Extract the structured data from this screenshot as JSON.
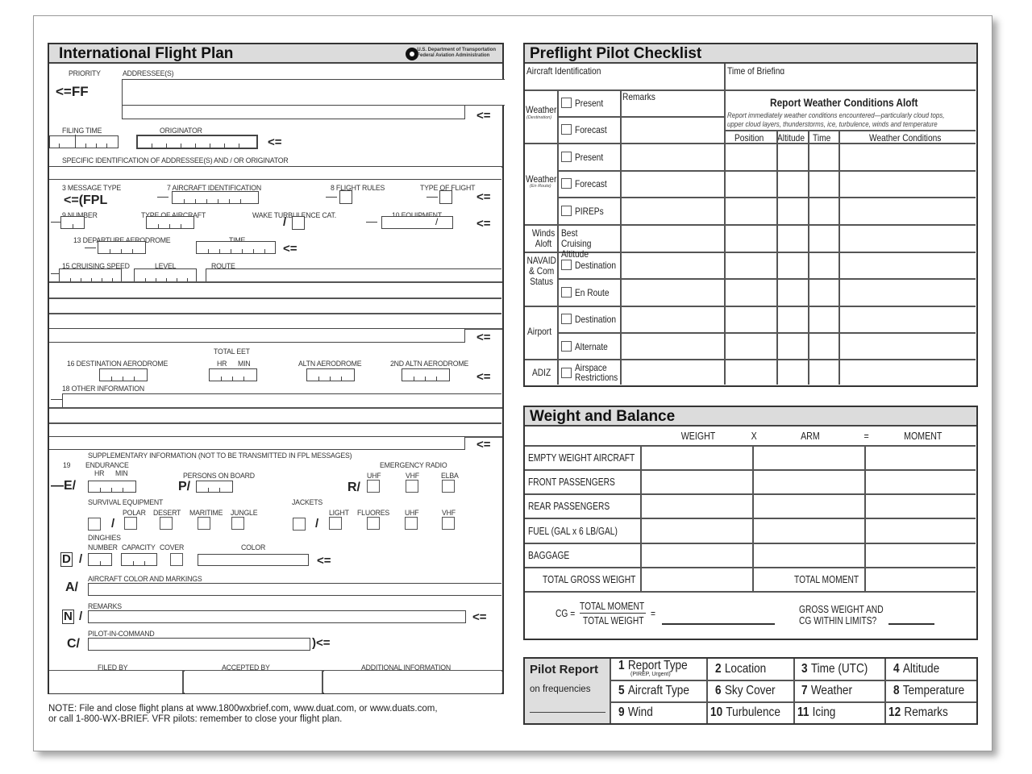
{
  "flight_plan": {
    "title": "International Flight Plan",
    "agency_line1": "U.S. Department of Transportation",
    "agency_line2": "Federal Aviation Administration",
    "priority_label": "PRIORITY",
    "priority_value": "<=FF",
    "addressees_label": "ADDRESSEE(S)",
    "filing_time_label": "FILING TIME",
    "originator_label": "ORIGINATOR",
    "specific_id_label": "SPECIFIC IDENTIFICATION OF ADDRESSEE(S) AND / OR ORIGINATOR",
    "message_type_label": "3 MESSAGE TYPE",
    "message_type_value": "<=(FPL",
    "aircraft_id_label": "7 AIRCRAFT IDENTIFICATION",
    "flight_rules_label": "8 FLIGHT RULES",
    "type_of_flight_label": "TYPE OF FLIGHT",
    "number_label": "9 NUMBER",
    "type_of_aircraft_label": "TYPE OF AIRCRAFT",
    "wake_turbulence_label": "WAKE TURBULENCE CAT.",
    "equipment_label": "10 EQUIPMENT",
    "departure_aerodrome_label": "13 DEPARTURE AERODROME",
    "time_label": "TIME",
    "cruising_speed_label": "15 CRUISING SPEED",
    "level_label": "LEVEL",
    "route_label": "ROUTE",
    "total_eet_label": "TOTAL  EET",
    "hr_label": "HR",
    "min_label": "MIN",
    "destination_label": "16 DESTINATION AERODROME",
    "altn_label": "ALTN  AERODROME",
    "altn2_label": "2ND  ALTN  AERODROME",
    "other_info_label": "18 OTHER INFORMATION",
    "supplementary_label": "SUPPLEMENTARY INFORMATION (NOT TO BE TRANSMITTED IN FPL MESSAGES)",
    "item19_label": "19",
    "endurance_label": "ENDURANCE",
    "persons_label": "PERSONS ON BOARD",
    "emergency_radio_label": "EMERGENCY RADIO",
    "uhf_label": "UHF",
    "vhf_label": "VHF",
    "elba_label": "ELBA",
    "e_mark": "—E/",
    "p_mark": "P/",
    "r_mark": "R/",
    "survival_label": "SURVIVAL EQUIPMENT",
    "polar_label": "POLAR",
    "desert_label": "DESERT",
    "maritime_label": "MARITIME",
    "jungle_label": "JUNGLE",
    "jackets_label": "JACKETS",
    "light_label": "LIGHT",
    "fluores_label": "FLUORES",
    "dinghies_label": "DINGHIES",
    "number2_label": "NUMBER",
    "capacity_label": "CAPACITY",
    "cover_label": "COVER",
    "color_label": "COLOR",
    "d_mark": "D",
    "a_mark": "A/",
    "aircraft_color_label": "AIRCRAFT COLOR AND MARKINGS",
    "n_mark": "N",
    "remarks_label": "REMARKS",
    "c_mark": "C/",
    "pic_label": "PILOT-IN-COMMAND",
    "pic_end": ")<=",
    "filed_by_label": "FILED BY",
    "accepted_by_label": "ACCEPTED BY",
    "additional_info_label": "ADDITIONAL INFORMATION",
    "end_arrow": "<=",
    "slash": "/",
    "dash": "—"
  },
  "note": {
    "line1": "NOTE: File and close flight plans at www.1800wxbrief.com, www.duat.com, or www.duats.com,",
    "line2": "or call 1-800-WX-BRIEF. VFR pilots: remember to close your flight plan."
  },
  "checklist": {
    "title": "Preflight Pilot Checklist",
    "aircraft_id_label": "Aircraft Identification",
    "time_of_briefing_label": "Time of Briefing",
    "remarks_label": "Remarks",
    "report_title": "Report Weather Conditions Aloft",
    "report_desc_line1": "Report immediately weather conditions encountered—particularly cloud tops,",
    "report_desc_line2": "upper cloud layers, thunderstorms, ice, turbulence, winds and temperature",
    "columns": [
      "Position",
      "Altitude",
      "Time",
      "Weather Conditions"
    ],
    "groups": [
      {
        "label": "Weather",
        "sub": "(Destination)",
        "items": [
          "Present",
          "Forecast"
        ]
      },
      {
        "label": "Weather",
        "sub": "(En Route)",
        "items": [
          "Present",
          "Forecast",
          "PIREPs"
        ]
      },
      {
        "label": "Winds Aloft",
        "sub": "",
        "items": [
          "Best Cruising Altitude"
        ]
      },
      {
        "label": "NAVAID & Com Status",
        "sub": "",
        "items": [
          "Destination",
          "En Route"
        ]
      },
      {
        "label": "Airport",
        "sub": "",
        "items": [
          "Destination",
          "Alternate"
        ]
      },
      {
        "label": "ADIZ",
        "sub": "",
        "items": [
          "Airspace Restrictions"
        ]
      }
    ]
  },
  "weight_balance": {
    "title": "Weight and Balance",
    "col_weight": "WEIGHT",
    "col_x": "X",
    "col_arm": "ARM",
    "col_eq": "=",
    "col_moment": "MOMENT",
    "rows": [
      "EMPTY WEIGHT AIRCRAFT",
      "FRONT PASSENGERS",
      "REAR PASSENGERS",
      "FUEL (GAL x 6 LB/GAL)",
      "BAGGAGE"
    ],
    "total_gross_weight": "TOTAL GROSS WEIGHT",
    "total_moment": "TOTAL MOMENT",
    "cg_label": "CG =",
    "cg_numerator": "TOTAL MOMENT",
    "cg_denominator": "TOTAL WEIGHT",
    "cg_eq": "=",
    "limits_line1": "GROSS WEIGHT AND",
    "limits_line2": "CG WITHIN LIMITS?"
  },
  "pilot_report": {
    "title": "Pilot Report",
    "subtitle": "on frequencies",
    "items": [
      {
        "num": "1",
        "label": "Report Type",
        "sub": "(PIREP, Urgent)"
      },
      {
        "num": "2",
        "label": "Location",
        "sub": ""
      },
      {
        "num": "3",
        "label": "Time (UTC)",
        "sub": ""
      },
      {
        "num": "4",
        "label": "Altitude",
        "sub": ""
      },
      {
        "num": "5",
        "label": "Aircraft Type",
        "sub": ""
      },
      {
        "num": "6",
        "label": "Sky Cover",
        "sub": ""
      },
      {
        "num": "7",
        "label": "Weather",
        "sub": ""
      },
      {
        "num": "8",
        "label": "Temperature",
        "sub": ""
      },
      {
        "num": "9",
        "label": "Wind",
        "sub": ""
      },
      {
        "num": "10",
        "label": "Turbulence",
        "sub": ""
      },
      {
        "num": "11",
        "label": "Icing",
        "sub": ""
      },
      {
        "num": "12",
        "label": "Remarks",
        "sub": ""
      }
    ]
  }
}
